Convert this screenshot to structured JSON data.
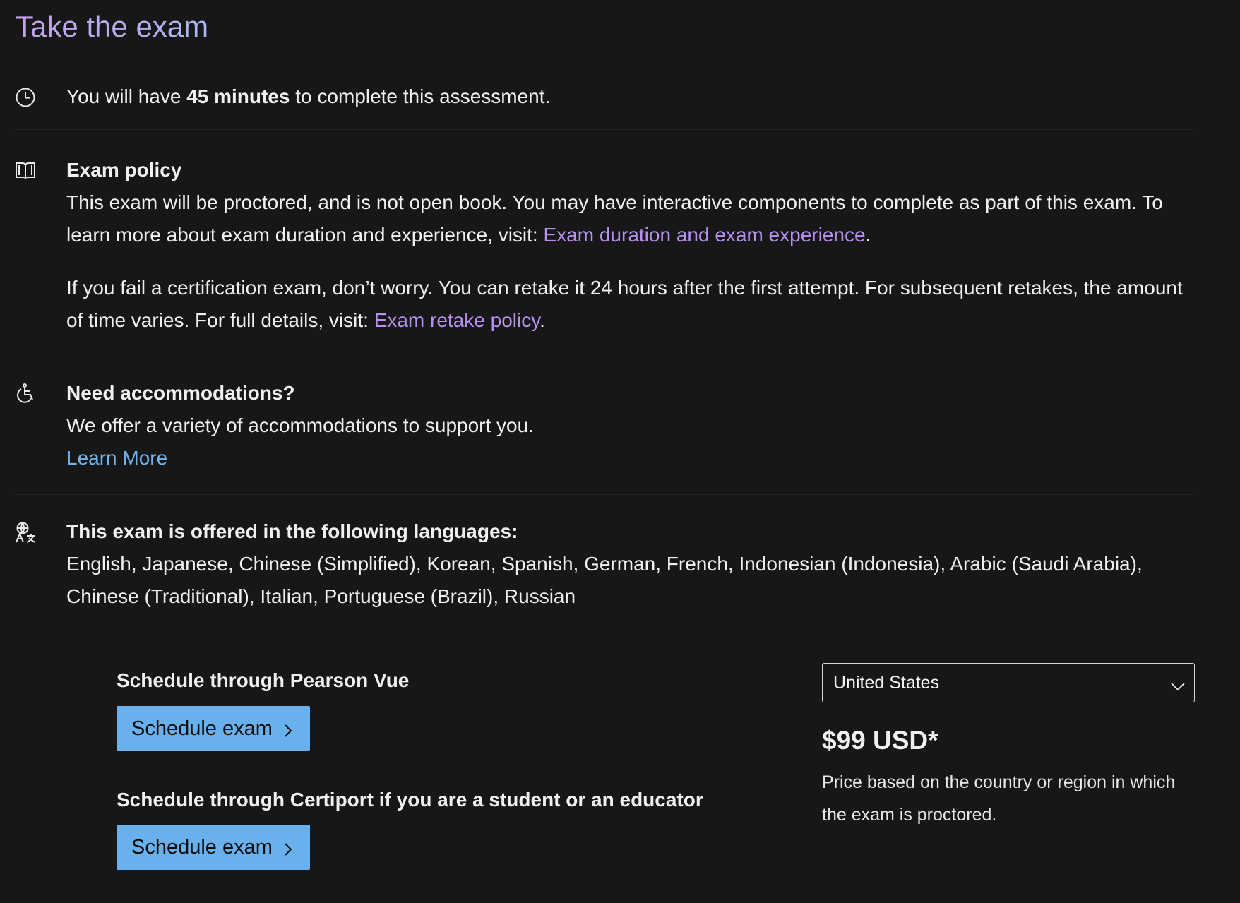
{
  "page": {
    "title": "Take the exam"
  },
  "duration": {
    "prefix": "You will have ",
    "value": "45 minutes",
    "suffix": " to complete this assessment."
  },
  "policy": {
    "heading": "Exam policy",
    "p1_text": "This exam will be proctored, and is not open book. You may have interactive components to complete as part of this exam. To learn more about exam duration and experience, visit: ",
    "p1_link": "Exam duration and exam experience",
    "p1_end": ".",
    "p2_text": "If you fail a certification exam, don’t worry. You can retake it 24 hours after the first attempt. For subsequent retakes, the amount of time varies. For full details, visit: ",
    "p2_link": "Exam retake policy",
    "p2_end": "."
  },
  "accommodations": {
    "heading": "Need accommodations?",
    "text": "We offer a variety of accommodations to support you.",
    "link": "Learn More"
  },
  "languages": {
    "heading": "This exam is offered in the following languages:",
    "list": "English, Japanese, Chinese (Simplified), Korean, Spanish, German, French, Indonesian (Indonesia), Arabic (Saudi Arabia), Chinese (Traditional), Italian, Portuguese (Brazil), Russian"
  },
  "schedule": {
    "pearson_label": "Schedule through Pearson Vue",
    "pearson_button": "Schedule exam",
    "certiport_label": "Schedule through Certiport if you are a student or an educator",
    "certiport_button": "Schedule exam"
  },
  "pricing": {
    "country_selected": "United States",
    "price": "$99 USD*",
    "note": "Price based on the country or region in which the exam is proctored."
  },
  "colors": {
    "background": "#171717",
    "link_purple": "#b890f0",
    "link_blue": "#6fb3ee",
    "button": "#69b1ec"
  },
  "icons": [
    "clock-icon",
    "book-icon",
    "accessibility-icon",
    "language-icon",
    "chevron-right-icon",
    "chevron-down-icon"
  ]
}
